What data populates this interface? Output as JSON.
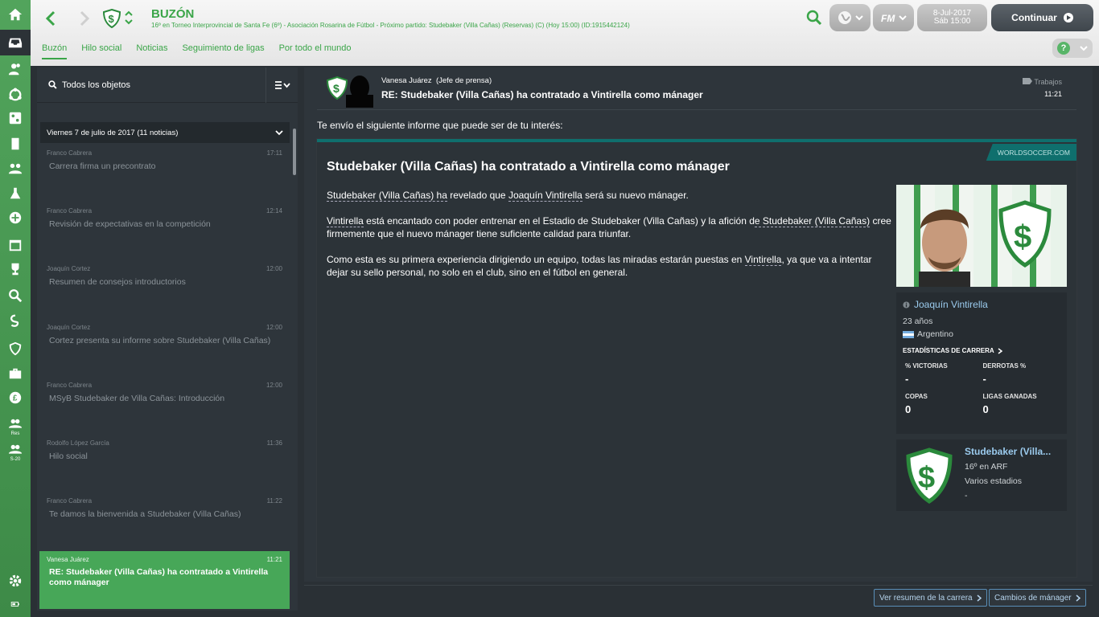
{
  "sidebar": {
    "items": [
      {
        "icon": "home-icon"
      },
      {
        "icon": "inbox-icon"
      },
      {
        "icon": "squad-icon"
      },
      {
        "icon": "dynamics-icon"
      },
      {
        "icon": "tactics-icon"
      },
      {
        "icon": "training-icon"
      },
      {
        "icon": "scouting-icon"
      },
      {
        "icon": "medical-icon"
      },
      {
        "icon": "staff-icon"
      },
      {
        "icon": "calendar-icon"
      },
      {
        "icon": "trophy-icon"
      },
      {
        "icon": "search-icon"
      },
      {
        "icon": "club-icon"
      },
      {
        "icon": "shield-icon"
      },
      {
        "icon": "briefcase-icon"
      },
      {
        "icon": "finance-icon"
      },
      {
        "icon": "reserves-icon",
        "label": "Res"
      },
      {
        "icon": "u20-icon",
        "label": "S-20"
      },
      {
        "icon": "settings-icon"
      },
      {
        "icon": "battery-icon"
      }
    ]
  },
  "header": {
    "title": "BUZÓN",
    "subtitle": "16º en Torneo Interprovincial de Santa Fe (6º) - Asociación Rosarina de Fútbol - Próximo partido: Studebaker (Villa Cañas) (Reservas) (C) (Hoy 15:00) (ID:1915442124)",
    "date": "8-Jul-2017",
    "time": "Sáb 15:00",
    "continue_label": "Continuar"
  },
  "tabs": [
    "Buzón",
    "Hilo social",
    "Noticias",
    "Seguimiento de ligas",
    "Por todo el mundo"
  ],
  "inbox": {
    "search_label": "Todos los objetos",
    "day_header": "Viernes 7 de julio de 2017 (11 noticias)",
    "messages": [
      {
        "from": "Franco Cabrera",
        "time": "17:11",
        "subject": "Carrera firma un precontrato"
      },
      {
        "from": "Franco Cabrera",
        "time": "12:14",
        "subject": "Revisión de expectativas en la competición"
      },
      {
        "from": "Joaquín Cortez",
        "time": "12:00",
        "subject": "Resumen de consejos introductorios"
      },
      {
        "from": "Joaquín Cortez",
        "time": "12:00",
        "subject": "Cortez presenta su informe sobre Studebaker (Villa Cañas)"
      },
      {
        "from": "Franco Cabrera",
        "time": "12:00",
        "subject": "MSyB Studebaker de Villa Cañas: Introducción"
      },
      {
        "from": "Rodolfo López García",
        "time": "11:36",
        "subject": "Hilo social"
      },
      {
        "from": "Franco Cabrera",
        "time": "11:22",
        "subject": "Te damos la bienvenida a Studebaker (Villa Cañas)"
      },
      {
        "from": "Vanesa Juárez",
        "time": "11:21",
        "subject": "RE: Studebaker (Villa Cañas) ha contratado a Vintirella como mánager"
      }
    ]
  },
  "message": {
    "from": "Vanesa Juárez",
    "role": "(Jefe de prensa)",
    "subject": "RE: Studebaker (Villa Cañas) ha contratado a Vintirella como mánager",
    "category": "Trabajos",
    "time": "11:21",
    "intro": "Te envío el siguiente informe que puede ser de tu interés:",
    "source": "WORLDSOCCER.COM",
    "article_title": "Studebaker (Villa Cañas) ha contratado a Vintirella como mánager",
    "p1": {
      "a": "Studebaker (Villa Cañas) ha",
      "b": " revelado que ",
      "c": "Joaquín Vintirella",
      "d": " será su nuevo mánager."
    },
    "p2": {
      "a": "Vintirella",
      "b": " está encantado con poder entrenar en el Estadio de Studebaker (Villa Cañas) y la afición d",
      "c": "e Studebaker (Villa Cañas)",
      "d": " cree firmemente que el nuevo mánager tiene suficiente calidad para triunfar."
    },
    "p3": {
      "a": "Como esta es su primera experiencia dirigiendo un equipo, todas las miradas estarán puestas en ",
      "b": "Vintirella",
      "c": ", ya que va a intentar dejar su sello personal, no solo en el club, sino en el fútbol en general."
    }
  },
  "manager_card": {
    "name": "Joaquín Vintirella",
    "age": "23 años",
    "nationality": "Argentino",
    "career_stats_label": "ESTADÍSTICAS DE CARRERA",
    "stats": [
      {
        "label": "% VICTORIAS",
        "value": "-"
      },
      {
        "label": "DERROTAS %",
        "value": "-"
      },
      {
        "label": "COPAS",
        "value": "0"
      },
      {
        "label": "LIGAS GANADAS",
        "value": "0"
      }
    ]
  },
  "club_card": {
    "name": "Studebaker (Villa...",
    "position": "16º en ARF",
    "stadium": "Varios estadios",
    "extra": "-"
  },
  "footer": {
    "career_summary": "Ver resumen de la carrera",
    "manager_changes": "Cambios de mánager"
  },
  "colors": {
    "accent": "#3aa548",
    "article_border": "#0f6f6d",
    "link": "#9bcbee"
  }
}
